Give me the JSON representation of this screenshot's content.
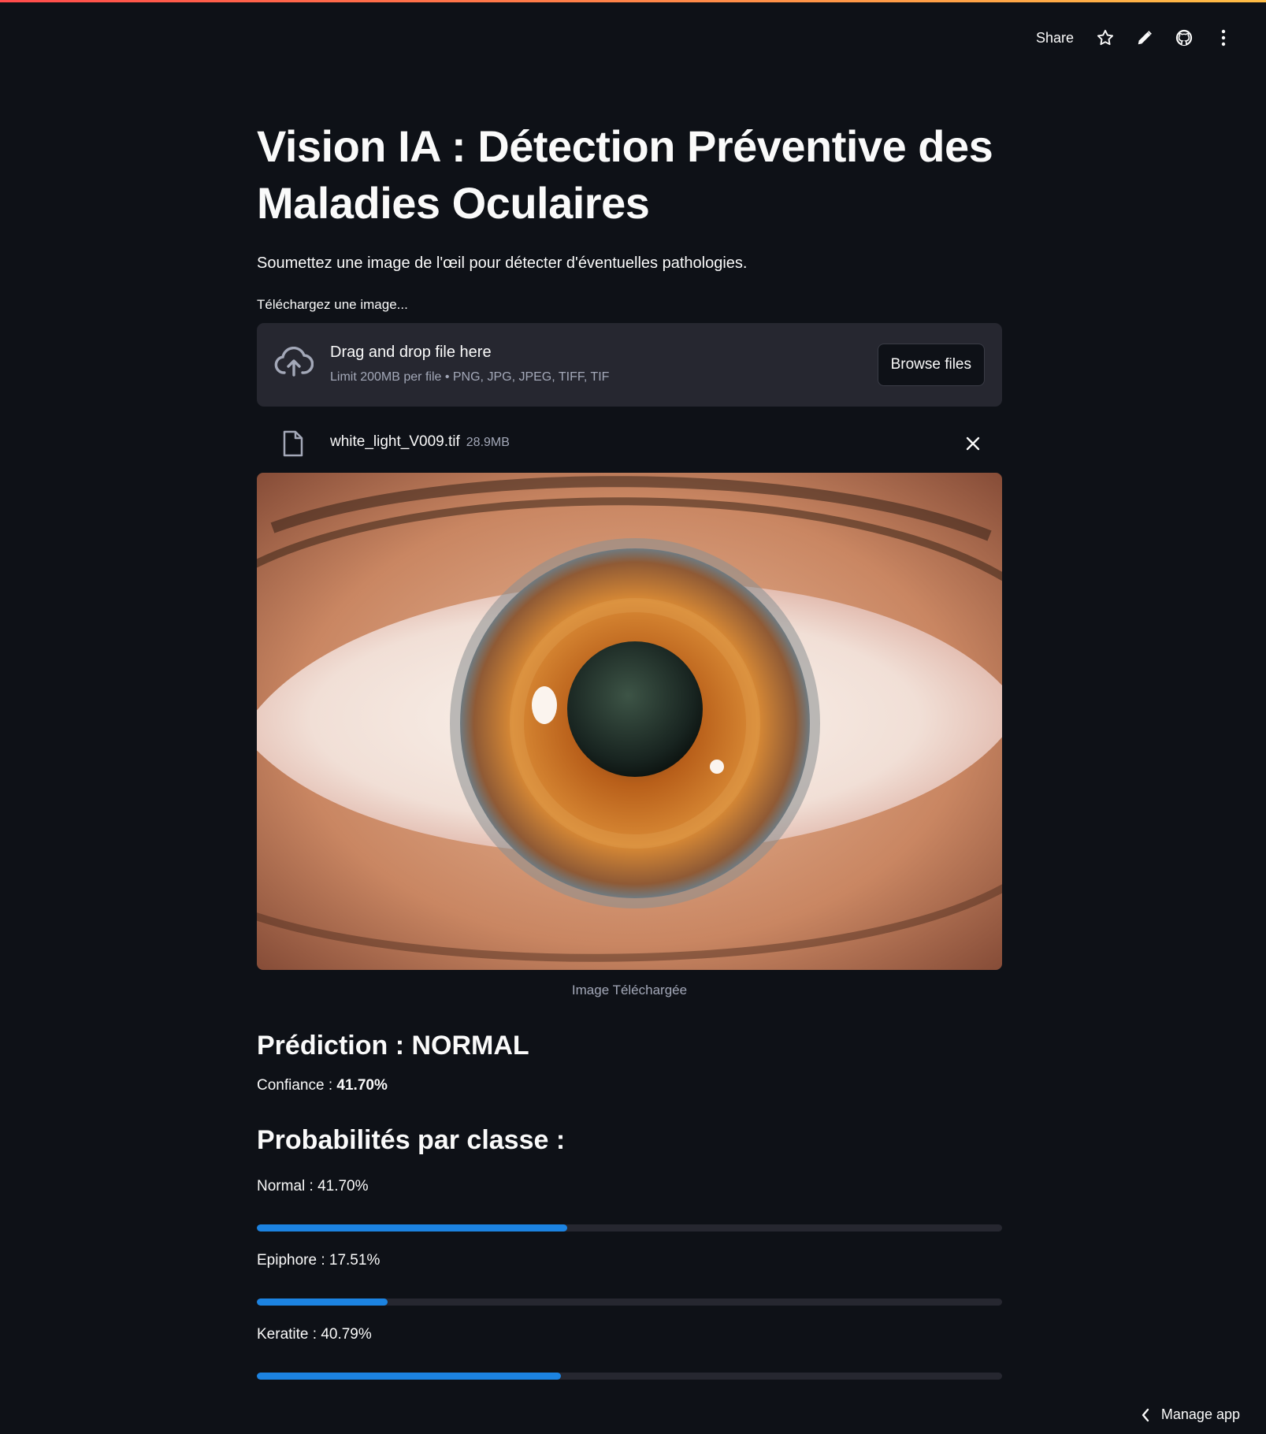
{
  "header": {
    "share_label": "Share",
    "icons": [
      "star-icon",
      "pencil-icon",
      "github-icon",
      "kebab-menu-icon"
    ]
  },
  "page": {
    "title": "Vision IA : Détection Préventive des Maladies Oculaires",
    "subtitle": "Soumettez une image de l'œil pour détecter d'éventuelles pathologies."
  },
  "uploader": {
    "label": "Téléchargez une image...",
    "drop_title": "Drag and drop file here",
    "limit": "Limit 200MB per file • PNG, JPG, JPEG, TIFF, TIF",
    "browse_label": "Browse files",
    "file": {
      "name": "white_light_V009.tif",
      "size": "28.9MB"
    }
  },
  "image": {
    "caption": "Image Téléchargée"
  },
  "prediction": {
    "title": "Prédiction : NORMAL",
    "confidence_prefix": "Confiance : ",
    "confidence_value": "41.70%"
  },
  "probabilities": {
    "title": "Probabilités par classe :",
    "items": [
      {
        "label": "Normal : 41.70%",
        "value": 0.417
      },
      {
        "label": "Epiphore : 17.51%",
        "value": 0.1751
      },
      {
        "label": "Keratite : 40.79%",
        "value": 0.4079
      }
    ]
  },
  "footer": {
    "manage_label": "Manage app"
  },
  "colors": {
    "background": "#0e1117",
    "surface": "#262730",
    "accent_bar": "#1c83e1",
    "top_stripe_start": "#ff4b4b",
    "top_stripe_end": "#ffbd45"
  }
}
